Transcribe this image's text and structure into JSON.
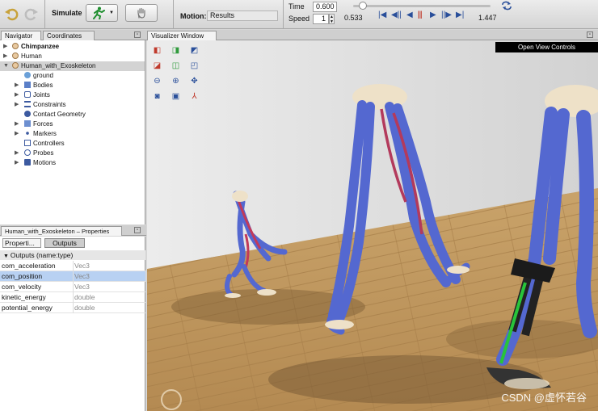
{
  "toolbar": {
    "simulate_label": "Simulate",
    "motion_label": "Motion:",
    "motion_value": "Results",
    "time_label": "Time",
    "time_value": "0.600",
    "speed_label": "Speed",
    "speed_value": "1",
    "start_time": "0.533",
    "end_time": "1.447",
    "time_progress": 0.07
  },
  "navigator": {
    "tabs": [
      "Navigator",
      "Coordinates"
    ],
    "items": [
      {
        "label": "Chimpanzee",
        "bold": true
      },
      {
        "label": "Human"
      },
      {
        "label": "Human_with_Exoskeleton"
      },
      {
        "label": "ground"
      },
      {
        "label": "Bodies"
      },
      {
        "label": "Joints"
      },
      {
        "label": "Constraints"
      },
      {
        "label": "Contact Geometry"
      },
      {
        "label": "Forces"
      },
      {
        "label": "Markers"
      },
      {
        "label": "Controllers"
      },
      {
        "label": "Probes"
      },
      {
        "label": "Motions"
      }
    ]
  },
  "properties": {
    "title": "Human_with_Exoskeleton – Properties",
    "tabs": [
      "Properti...",
      "Outputs"
    ],
    "section": "Outputs (name:type)",
    "rows": [
      {
        "name": "com_acceleration",
        "type": "Vec3"
      },
      {
        "name": "com_position",
        "type": "Vec3"
      },
      {
        "name": "com_velocity",
        "type": "Vec3"
      },
      {
        "name": "kinetic_energy",
        "type": "double"
      },
      {
        "name": "potential_energy",
        "type": "double"
      }
    ]
  },
  "visualizer": {
    "tab_label": "Visualizer Window",
    "open_view_controls": "Open View Controls",
    "watermark": "CSDN @虚怀若谷"
  },
  "colors": {
    "accent": "#2a4f9a",
    "selection": "#b8d1f2",
    "muscle_blue": "#5468d0",
    "muscle_red": "#c23a5a",
    "floor": "#c29a62"
  }
}
